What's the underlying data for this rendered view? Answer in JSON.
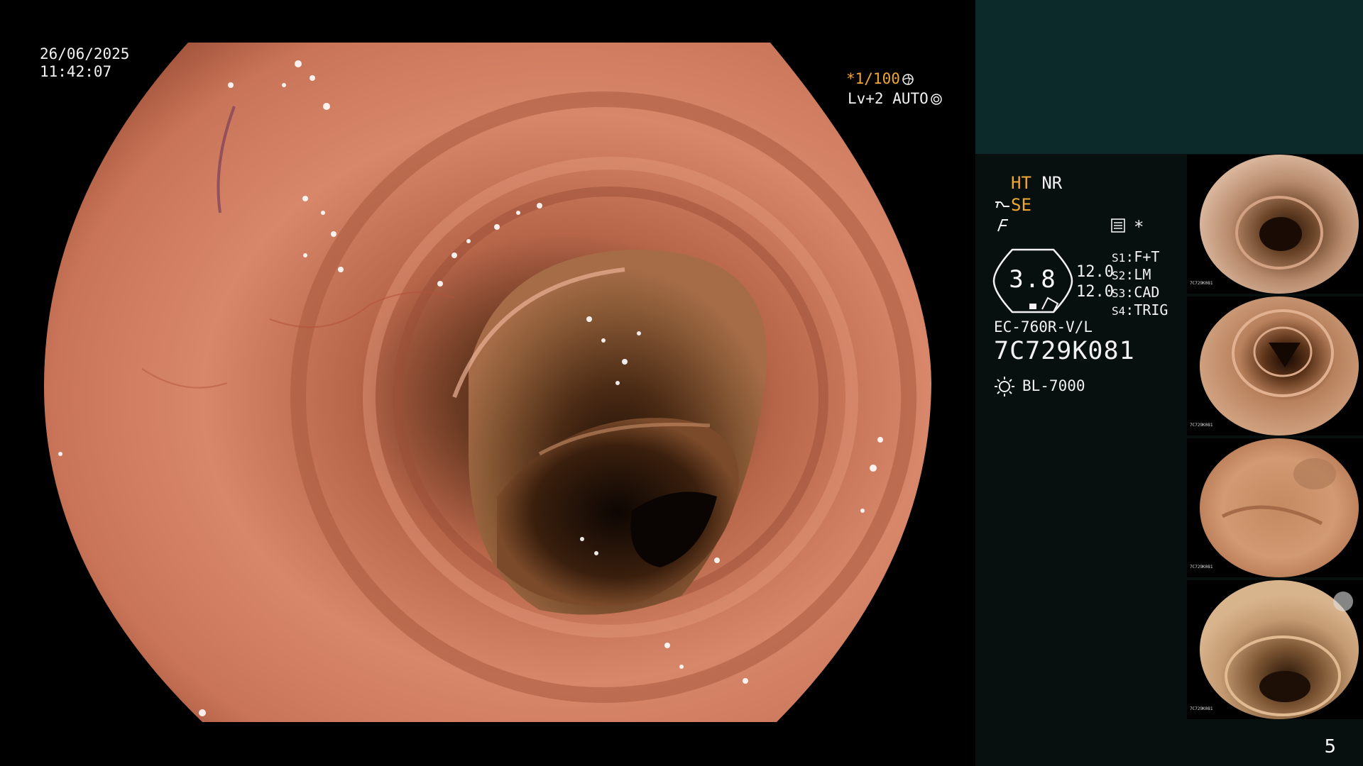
{
  "overlay": {
    "date": "26/06/2025",
    "time": "11:42:07",
    "shutter": "*1/100",
    "iris": "Lv+2 AUTO"
  },
  "panel": {
    "mode_ht": "HT",
    "mode_nr": "NR",
    "se_label": "SE",
    "gauge_value": "3.8",
    "gain_top": "12.0",
    "gain_bottom": "12.0",
    "switches": [
      {
        "key": "S1",
        "value": "F+T"
      },
      {
        "key": "S2",
        "value": "LM"
      },
      {
        "key": "S3",
        "value": "CAD"
      },
      {
        "key": "S4",
        "value": "TRIG"
      }
    ],
    "asterisk": "*",
    "scope_model": "EC-760R-V/L",
    "serial": "7C729K081",
    "light_source": "BL-7000"
  },
  "thumbnails": [
    {
      "serial": "7C729K081"
    },
    {
      "serial": "7C729K081"
    },
    {
      "serial": "7C729K081"
    },
    {
      "serial": "7C729K081"
    }
  ],
  "page_number": "5",
  "colors": {
    "accent_orange": "#f0a830",
    "panel_bg": "#07100f",
    "header_teal": "#0d2a2b"
  }
}
